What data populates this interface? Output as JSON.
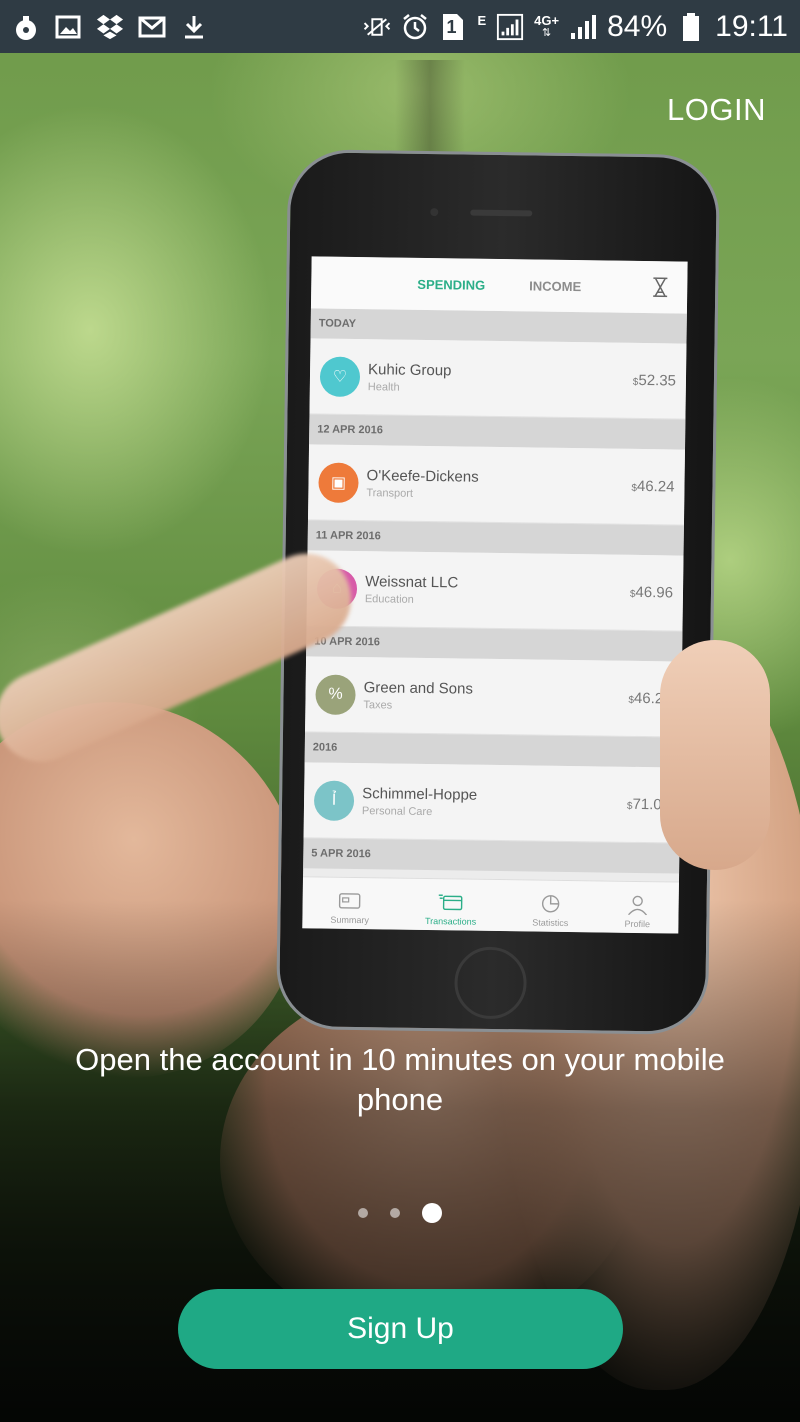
{
  "status_bar": {
    "icons_left": [
      "bomb-icon",
      "image-icon",
      "dropbox-icon",
      "mail-icon",
      "download-icon"
    ],
    "icons_right": [
      "vibrate-icon",
      "alarm-icon",
      "sim-icon",
      "signal-icon",
      "network-icon",
      "battery-icon"
    ],
    "sim_label": "1",
    "network_e": "E",
    "network_4g": "4G+",
    "battery_percent": "84%",
    "time": "19:11"
  },
  "header": {
    "login_label": "LOGIN"
  },
  "phone_screen": {
    "tabs": [
      {
        "label": "SPENDING",
        "active": true
      },
      {
        "label": "INCOME",
        "active": false
      }
    ],
    "groups": [
      {
        "date": "TODAY",
        "transactions": [
          {
            "name": "Kuhic Group",
            "category": "Health",
            "currency": "$",
            "amount": "52.35",
            "color": "#4fc8cf"
          }
        ]
      },
      {
        "date": "12 APR 2016",
        "transactions": [
          {
            "name": "O'Keefe-Dickens",
            "category": "Transport",
            "currency": "$",
            "amount": "46.24",
            "color": "#ee7a3a"
          }
        ]
      },
      {
        "date": "11 APR 2016",
        "transactions": [
          {
            "name": "Weissnat LLC",
            "category": "Education",
            "currency": "$",
            "amount": "46.96",
            "color": "#d75aa8"
          }
        ]
      },
      {
        "date": "10 APR 2016",
        "transactions": [
          {
            "name": "Green and Sons",
            "category": "Taxes",
            "currency": "$",
            "amount": "46.29",
            "color": "#9aa37a"
          }
        ]
      },
      {
        "date": "2016",
        "transactions": [
          {
            "name": "Schimmel-Hoppe",
            "category": "Personal Care",
            "currency": "$",
            "amount": "71.03",
            "color": "#7cc4c8"
          }
        ]
      },
      {
        "date": "5 APR 2016",
        "transactions": []
      }
    ],
    "nav": [
      {
        "label": "Summary",
        "active": false
      },
      {
        "label": "Transactions",
        "active": true
      },
      {
        "label": "Statistics",
        "active": false
      },
      {
        "label": "Profile",
        "active": false
      }
    ]
  },
  "onboarding": {
    "caption": "Open the account in 10 minutes on your mobile phone",
    "page_count": 3,
    "active_page": 3
  },
  "signup_label": "Sign Up",
  "colors": {
    "accent": "#1fa985",
    "status_bar_bg": "#2f3b44"
  }
}
